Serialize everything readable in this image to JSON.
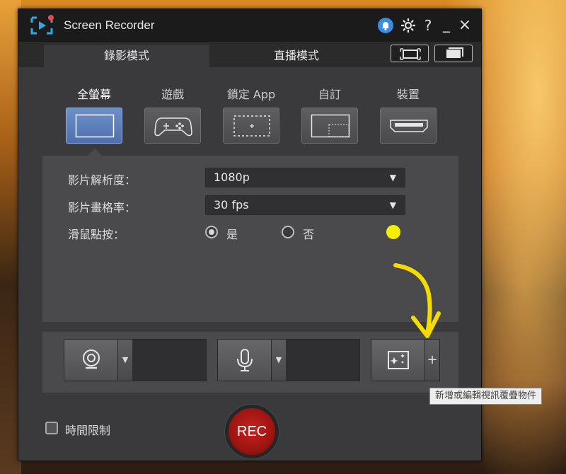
{
  "window": {
    "title": "Screen Recorder",
    "controls": {
      "help_label": "?",
      "minimize_label": "_",
      "close_label": "×"
    }
  },
  "tabs": [
    {
      "label": "錄影模式",
      "active": true
    },
    {
      "label": "直播模式",
      "active": false
    }
  ],
  "capture_sources": [
    {
      "label": "全螢幕",
      "icon": "fullscreen-icon",
      "active": true
    },
    {
      "label": "遊戲",
      "icon": "gamepad-icon",
      "active": false
    },
    {
      "label": "鎖定 App",
      "icon": "lock-app-icon",
      "active": false
    },
    {
      "label": "自訂",
      "icon": "custom-area-icon",
      "active": false
    },
    {
      "label": "裝置",
      "icon": "hdmi-device-icon",
      "active": false
    }
  ],
  "settings": {
    "resolution_label": "影片解析度：",
    "resolution_value": "1080p",
    "framerate_label": "影片畫格率：",
    "framerate_value": "30 fps",
    "mouse_click_label": "滑鼠點按：",
    "mouse_click_yes": "是",
    "mouse_click_no": "否",
    "mouse_click_selected": "是",
    "mouse_click_color": "#f5f000"
  },
  "io": {
    "webcam_icon": "webcam-icon",
    "mic_icon": "microphone-icon",
    "overlay_icon": "overlay-sparkle-icon",
    "overlay_add_label": "+",
    "dropdown_arrow": "▼"
  },
  "tooltip": "新增或編輯視訊覆疊物件",
  "time_limit_label": "時間限制",
  "rec_label": "REC",
  "colors": {
    "accent_blue": "#5f80bf",
    "rec_red": "#b01a17",
    "annotation_yellow": "#f5dc00"
  }
}
